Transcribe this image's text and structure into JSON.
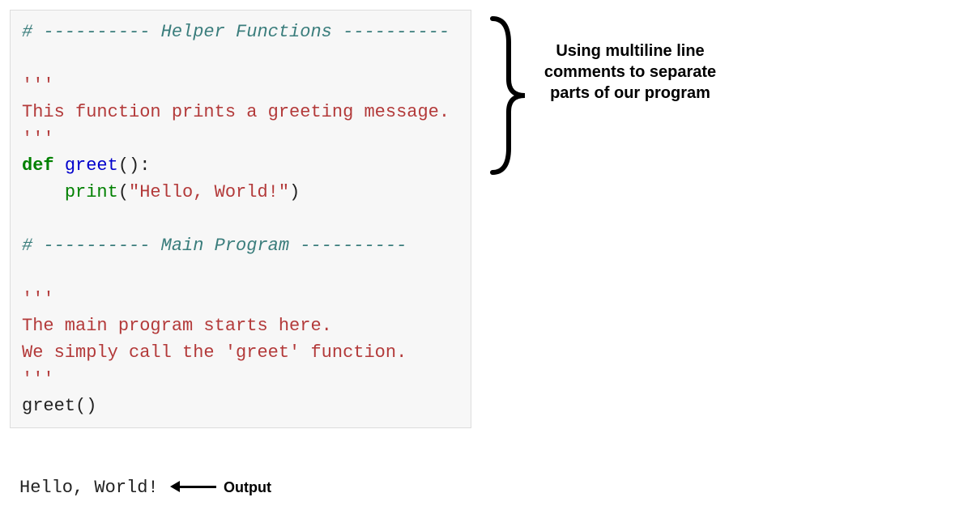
{
  "code": {
    "line1_comment": "# ---------- Helper Functions ----------",
    "blank": "",
    "docstring_open1": "'''",
    "docstring_text1": "This function prints a greeting message.",
    "docstring_close1": "'''",
    "def_kw": "def",
    "func_name": "greet",
    "paren_colon": "():",
    "indent": "    ",
    "print_builtin": "print",
    "print_open": "(",
    "print_string": "\"Hello, World!\"",
    "print_close": ")",
    "line2_comment": "# ---------- Main Program ----------",
    "docstring_open2": "'''",
    "docstring_text2a": "The main program starts here.",
    "docstring_text2b": "We simply call the 'greet' function.",
    "docstring_close2": "'''",
    "call": "greet()"
  },
  "output": {
    "text": "Hello, World!",
    "label": "Output"
  },
  "annotation": {
    "text": "Using multiline line comments to separate parts of our program"
  },
  "colors": {
    "comment": "#3a7d7c",
    "docstring": "#b33a3a",
    "keyword": "#008000",
    "funcname": "#0000cc",
    "background": "#f7f7f7"
  }
}
